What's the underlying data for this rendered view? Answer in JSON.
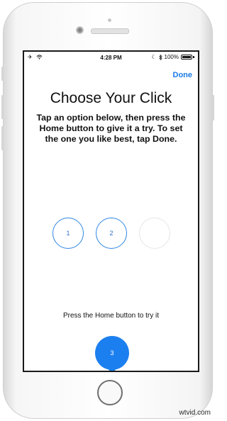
{
  "status_bar": {
    "time": "4:28 PM",
    "battery_percent": "100%",
    "left_icons": [
      "airplane-icon",
      "wifi-icon"
    ],
    "right_icons": [
      "moon-icon",
      "bluetooth-icon",
      "battery-icon"
    ]
  },
  "nav": {
    "done_label": "Done"
  },
  "content": {
    "title": "Choose Your Click",
    "instructions": "Tap an option below, then press the Home button to give it a try. To set the one you like best, tap Done.",
    "options": [
      {
        "label": "1"
      },
      {
        "label": "2"
      },
      {
        "label": ""
      }
    ],
    "hint": "Press the Home button to try it",
    "selected_bubble_label": "3"
  },
  "colors": {
    "accent": "#1c7ff0",
    "link": "#1a7be6"
  },
  "watermark": "wtvid.com"
}
